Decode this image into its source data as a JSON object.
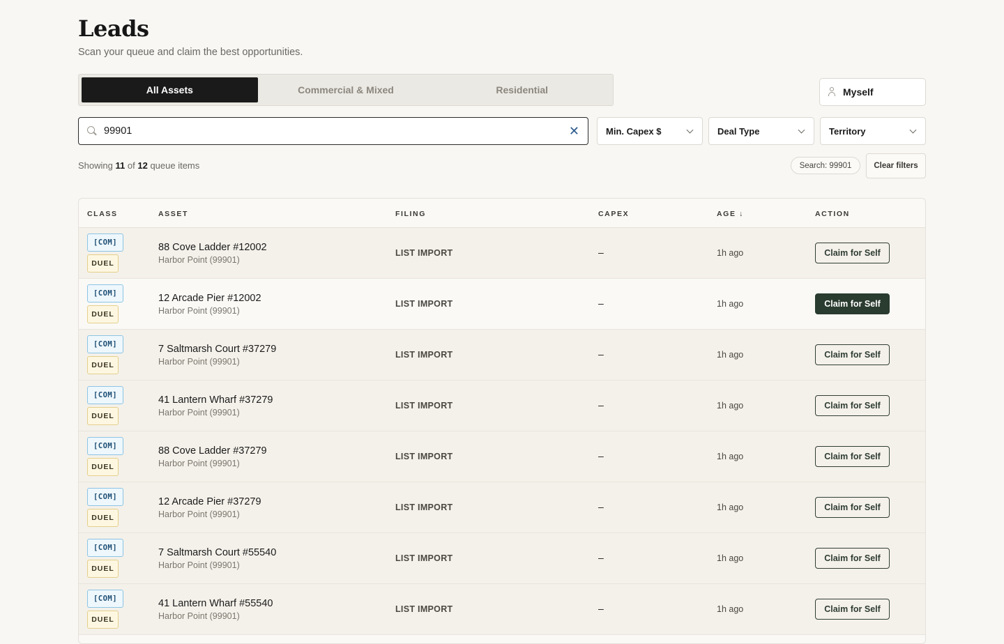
{
  "header": {
    "title": "Leads",
    "subtitle": "Scan your queue and claim the best opportunities."
  },
  "tabs": [
    {
      "label": "All Assets",
      "active": true
    },
    {
      "label": "Commercial & Mixed",
      "active": false
    },
    {
      "label": "Residential",
      "active": false
    }
  ],
  "assignee": {
    "label": "Myself",
    "icon": "user-icon"
  },
  "search": {
    "value": "99901",
    "icon": "search-icon",
    "clear_icon": "close-icon"
  },
  "filters": {
    "min_capex": "Min. Capex $",
    "deal_type": "Deal Type",
    "territory": "Territory"
  },
  "results": {
    "prefix": "Showing",
    "shown": "11",
    "of": "of",
    "total": "12",
    "suffix": "queue items",
    "active_chip": "Search: 99901",
    "clear_filters": "Clear filters"
  },
  "table": {
    "columns": [
      "CLASS",
      "ASSET",
      "FILING",
      "CAPEX",
      "AGE ↓",
      "ACTION"
    ],
    "rows": [
      {
        "class_tag": "[COM]",
        "flag": "DUEL",
        "asset": "88 Cove Ladder #12002",
        "location": "Harbor Point (99901)",
        "filing": "LIST IMPORT",
        "capex": "–",
        "age": "1h ago",
        "action": "Claim for Self"
      },
      {
        "class_tag": "[COM]",
        "flag": "DUEL",
        "asset": "12 Arcade Pier #12002",
        "location": "Harbor Point (99901)",
        "filing": "LIST IMPORT",
        "capex": "–",
        "age": "1h ago",
        "action": "Claim for Self"
      },
      {
        "class_tag": "[COM]",
        "flag": "DUEL",
        "asset": "7 Saltmarsh Court #37279",
        "location": "Harbor Point (99901)",
        "filing": "LIST IMPORT",
        "capex": "–",
        "age": "1h ago",
        "action": "Claim for Self"
      },
      {
        "class_tag": "[COM]",
        "flag": "DUEL",
        "asset": "41 Lantern Wharf #37279",
        "location": "Harbor Point (99901)",
        "filing": "LIST IMPORT",
        "capex": "–",
        "age": "1h ago",
        "action": "Claim for Self"
      },
      {
        "class_tag": "[COM]",
        "flag": "DUEL",
        "asset": "88 Cove Ladder #37279",
        "location": "Harbor Point (99901)",
        "filing": "LIST IMPORT",
        "capex": "–",
        "age": "1h ago",
        "action": "Claim for Self"
      },
      {
        "class_tag": "[COM]",
        "flag": "DUEL",
        "asset": "12 Arcade Pier #37279",
        "location": "Harbor Point (99901)",
        "filing": "LIST IMPORT",
        "capex": "–",
        "age": "1h ago",
        "action": "Claim for Self"
      },
      {
        "class_tag": "[COM]",
        "flag": "DUEL",
        "asset": "7 Saltmarsh Court #55540",
        "location": "Harbor Point (99901)",
        "filing": "LIST IMPORT",
        "capex": "–",
        "age": "1h ago",
        "action": "Claim for Self"
      },
      {
        "class_tag": "[COM]",
        "flag": "DUEL",
        "asset": "41 Lantern Wharf #55540",
        "location": "Harbor Point (99901)",
        "filing": "LIST IMPORT",
        "capex": "–",
        "age": "1h ago",
        "action": "Claim for Self"
      }
    ]
  },
  "colors": {
    "accent_dark": "#2a3b2f",
    "tab_active": "#1a1a1a",
    "com_badge_border": "#8cc4e4",
    "duel_badge_border": "#e4cf8a",
    "clear_icon": "#2a5a8c"
  }
}
